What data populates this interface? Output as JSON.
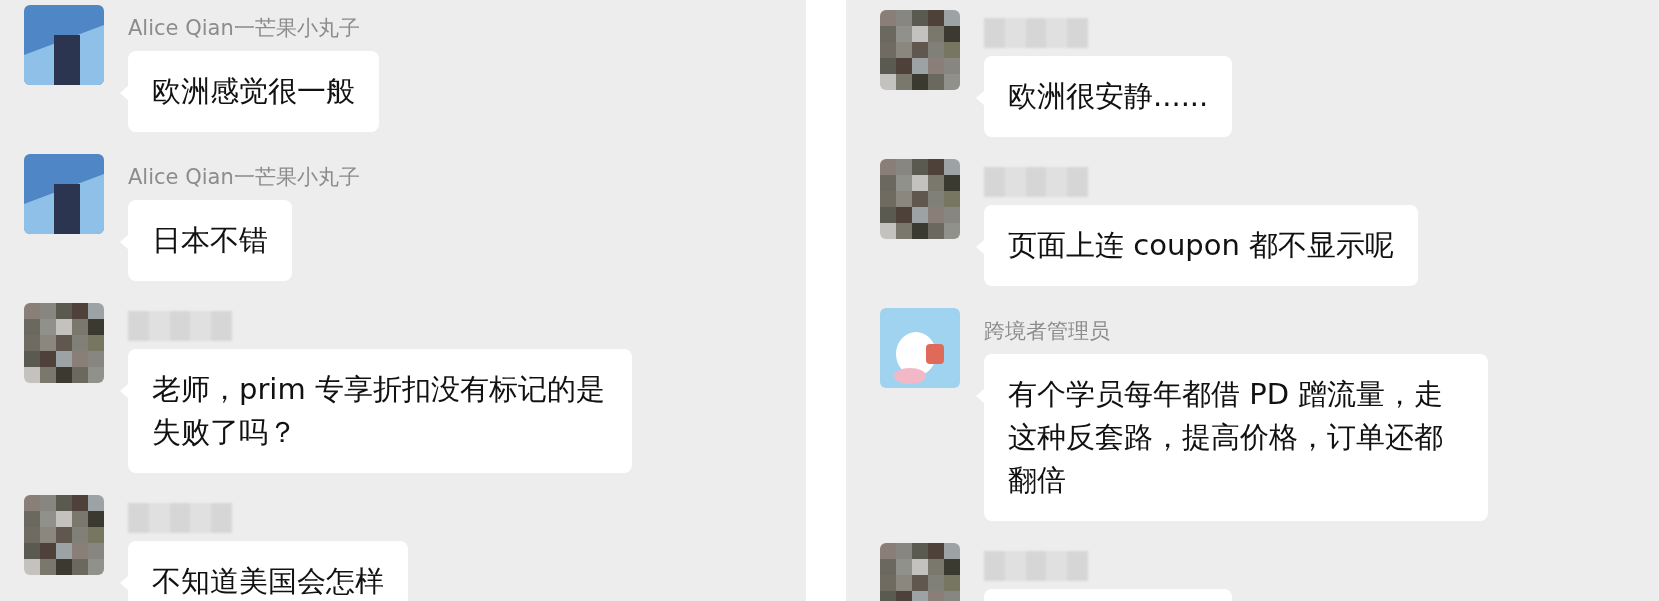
{
  "panels": [
    {
      "messages": [
        {
          "sender": "Alice Qian一芒果小丸子",
          "kind": "photo",
          "text": "欧洲感觉很一般"
        },
        {
          "sender": "Alice Qian一芒果小丸子",
          "kind": "photo",
          "text": "日本不错"
        },
        {
          "kind": "pixelated",
          "text": "老师，prim 专享折扣没有标记的是失败了吗？"
        },
        {
          "kind": "pixelated",
          "text": "不知道美国会怎样"
        }
      ]
    },
    {
      "messages": [
        {
          "kind": "pixelated",
          "text": "欧洲很安静......"
        },
        {
          "kind": "pixelated",
          "text": "页面上连 coupon 都不显示呢"
        },
        {
          "sender": "跨境者管理员",
          "kind": "cartoon",
          "text": "有个学员每年都借 PD 蹭流量，走这种反套路，提高价格，订单还都翻倍"
        },
        {
          "kind": "pixelated"
        }
      ]
    }
  ]
}
